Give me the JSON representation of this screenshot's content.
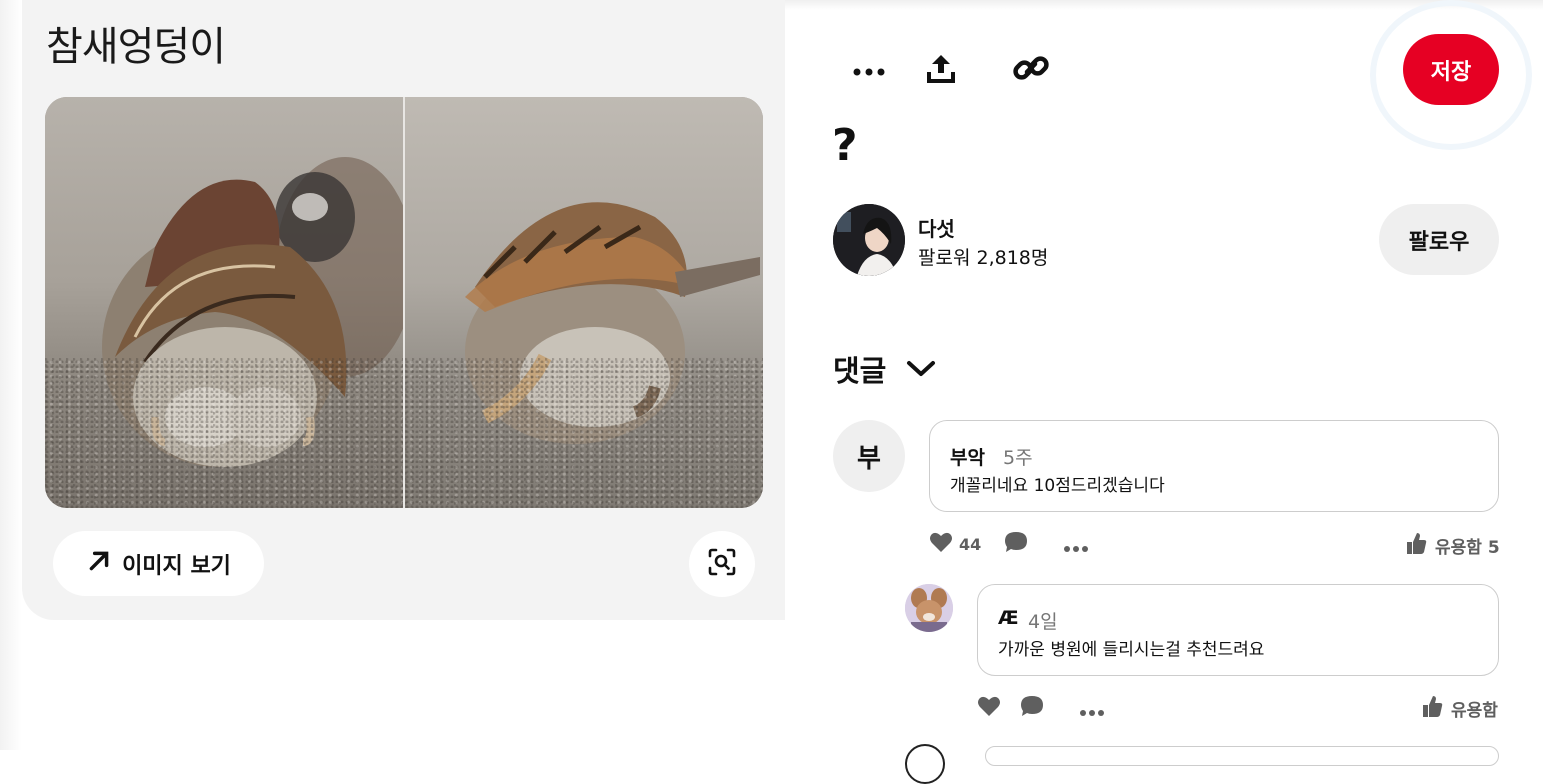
{
  "pin": {
    "title": "참새엉덩이",
    "view_image_label": "이미지 보기"
  },
  "toolbar": {
    "more_icon": "ellipsis-icon",
    "share_icon": "upload-share-icon",
    "link_icon": "link-icon",
    "save_label": "저장"
  },
  "content": {
    "heading": "?"
  },
  "creator": {
    "name": "다섯",
    "followers": "팔로워 2,818명",
    "follow_label": "팔로우"
  },
  "comments": {
    "header": "댓글",
    "items": [
      {
        "avatar_letter": "부",
        "author": "부악",
        "time": "5주",
        "text": "개꼴리네요 10점드리겠습니다",
        "likes": "44",
        "helpful": "유용함 5"
      },
      {
        "author": "Æ",
        "time": "4일",
        "text": "가까운 병원에 들리시는걸 추천드려요",
        "likes": "",
        "helpful": "유용함"
      }
    ]
  },
  "colors": {
    "save": "#e60023",
    "panel": "#f3f3f3",
    "chip": "#efefef",
    "muted": "#767676"
  }
}
